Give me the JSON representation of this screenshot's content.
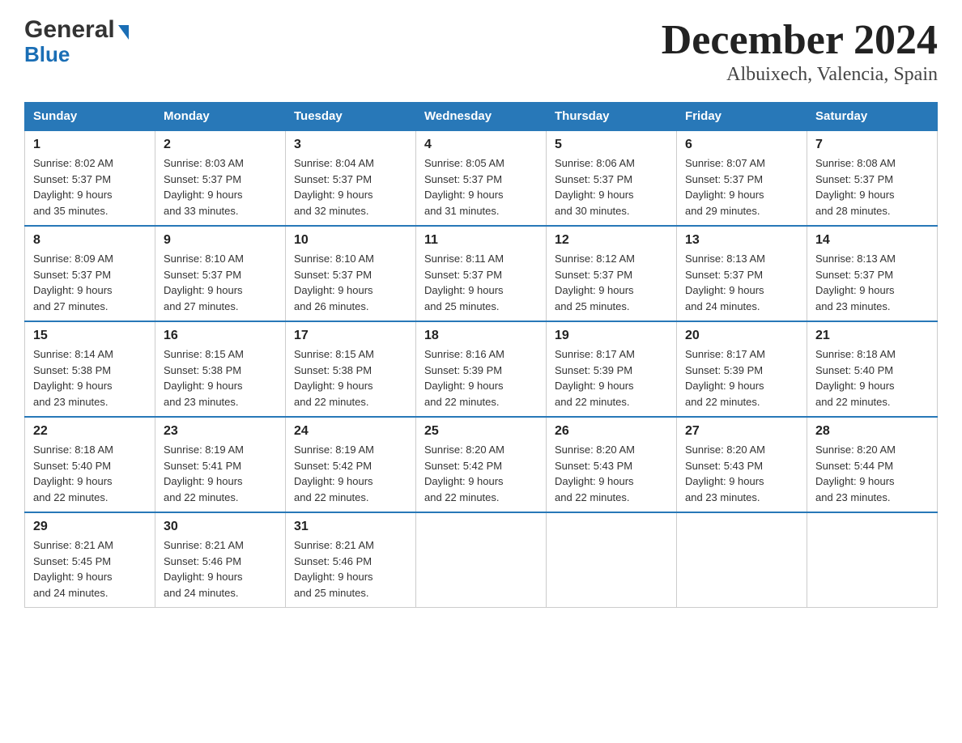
{
  "header": {
    "logo": {
      "general_text": "General",
      "blue_text": "Blue"
    },
    "title": "December 2024",
    "subtitle": "Albuixech, Valencia, Spain"
  },
  "calendar": {
    "weekdays": [
      "Sunday",
      "Monday",
      "Tuesday",
      "Wednesday",
      "Thursday",
      "Friday",
      "Saturday"
    ],
    "weeks": [
      [
        {
          "day": "1",
          "sunrise": "8:02 AM",
          "sunset": "5:37 PM",
          "daylight": "9 hours and 35 minutes."
        },
        {
          "day": "2",
          "sunrise": "8:03 AM",
          "sunset": "5:37 PM",
          "daylight": "9 hours and 33 minutes."
        },
        {
          "day": "3",
          "sunrise": "8:04 AM",
          "sunset": "5:37 PM",
          "daylight": "9 hours and 32 minutes."
        },
        {
          "day": "4",
          "sunrise": "8:05 AM",
          "sunset": "5:37 PM",
          "daylight": "9 hours and 31 minutes."
        },
        {
          "day": "5",
          "sunrise": "8:06 AM",
          "sunset": "5:37 PM",
          "daylight": "9 hours and 30 minutes."
        },
        {
          "day": "6",
          "sunrise": "8:07 AM",
          "sunset": "5:37 PM",
          "daylight": "9 hours and 29 minutes."
        },
        {
          "day": "7",
          "sunrise": "8:08 AM",
          "sunset": "5:37 PM",
          "daylight": "9 hours and 28 minutes."
        }
      ],
      [
        {
          "day": "8",
          "sunrise": "8:09 AM",
          "sunset": "5:37 PM",
          "daylight": "9 hours and 27 minutes."
        },
        {
          "day": "9",
          "sunrise": "8:10 AM",
          "sunset": "5:37 PM",
          "daylight": "9 hours and 27 minutes."
        },
        {
          "day": "10",
          "sunrise": "8:10 AM",
          "sunset": "5:37 PM",
          "daylight": "9 hours and 26 minutes."
        },
        {
          "day": "11",
          "sunrise": "8:11 AM",
          "sunset": "5:37 PM",
          "daylight": "9 hours and 25 minutes."
        },
        {
          "day": "12",
          "sunrise": "8:12 AM",
          "sunset": "5:37 PM",
          "daylight": "9 hours and 25 minutes."
        },
        {
          "day": "13",
          "sunrise": "8:13 AM",
          "sunset": "5:37 PM",
          "daylight": "9 hours and 24 minutes."
        },
        {
          "day": "14",
          "sunrise": "8:13 AM",
          "sunset": "5:37 PM",
          "daylight": "9 hours and 23 minutes."
        }
      ],
      [
        {
          "day": "15",
          "sunrise": "8:14 AM",
          "sunset": "5:38 PM",
          "daylight": "9 hours and 23 minutes."
        },
        {
          "day": "16",
          "sunrise": "8:15 AM",
          "sunset": "5:38 PM",
          "daylight": "9 hours and 23 minutes."
        },
        {
          "day": "17",
          "sunrise": "8:15 AM",
          "sunset": "5:38 PM",
          "daylight": "9 hours and 22 minutes."
        },
        {
          "day": "18",
          "sunrise": "8:16 AM",
          "sunset": "5:39 PM",
          "daylight": "9 hours and 22 minutes."
        },
        {
          "day": "19",
          "sunrise": "8:17 AM",
          "sunset": "5:39 PM",
          "daylight": "9 hours and 22 minutes."
        },
        {
          "day": "20",
          "sunrise": "8:17 AM",
          "sunset": "5:39 PM",
          "daylight": "9 hours and 22 minutes."
        },
        {
          "day": "21",
          "sunrise": "8:18 AM",
          "sunset": "5:40 PM",
          "daylight": "9 hours and 22 minutes."
        }
      ],
      [
        {
          "day": "22",
          "sunrise": "8:18 AM",
          "sunset": "5:40 PM",
          "daylight": "9 hours and 22 minutes."
        },
        {
          "day": "23",
          "sunrise": "8:19 AM",
          "sunset": "5:41 PM",
          "daylight": "9 hours and 22 minutes."
        },
        {
          "day": "24",
          "sunrise": "8:19 AM",
          "sunset": "5:42 PM",
          "daylight": "9 hours and 22 minutes."
        },
        {
          "day": "25",
          "sunrise": "8:20 AM",
          "sunset": "5:42 PM",
          "daylight": "9 hours and 22 minutes."
        },
        {
          "day": "26",
          "sunrise": "8:20 AM",
          "sunset": "5:43 PM",
          "daylight": "9 hours and 22 minutes."
        },
        {
          "day": "27",
          "sunrise": "8:20 AM",
          "sunset": "5:43 PM",
          "daylight": "9 hours and 23 minutes."
        },
        {
          "day": "28",
          "sunrise": "8:20 AM",
          "sunset": "5:44 PM",
          "daylight": "9 hours and 23 minutes."
        }
      ],
      [
        {
          "day": "29",
          "sunrise": "8:21 AM",
          "sunset": "5:45 PM",
          "daylight": "9 hours and 24 minutes."
        },
        {
          "day": "30",
          "sunrise": "8:21 AM",
          "sunset": "5:46 PM",
          "daylight": "9 hours and 24 minutes."
        },
        {
          "day": "31",
          "sunrise": "8:21 AM",
          "sunset": "5:46 PM",
          "daylight": "9 hours and 25 minutes."
        },
        null,
        null,
        null,
        null
      ]
    ],
    "labels": {
      "sunrise": "Sunrise:",
      "sunset": "Sunset:",
      "daylight": "Daylight:"
    }
  }
}
